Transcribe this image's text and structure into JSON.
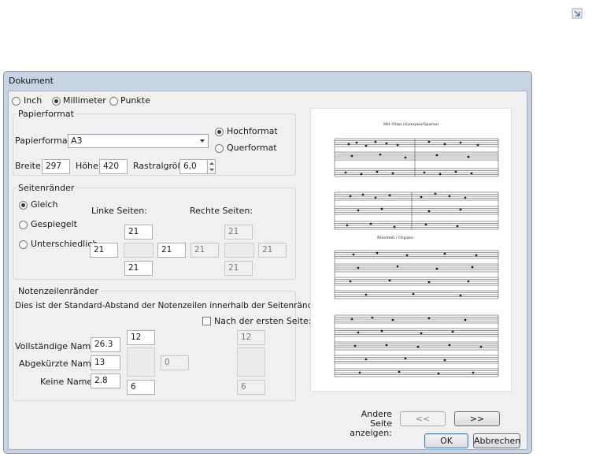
{
  "dialog": {
    "title": "Dokument"
  },
  "units": {
    "options": [
      "Inch",
      "Millimeter",
      "Punkte"
    ],
    "selected": "Millimeter"
  },
  "paper": {
    "group_title": "Papierformat",
    "format_label": "Papierformat:",
    "format_value": "A3",
    "orientation": [
      "Hochformat",
      "Querformat"
    ],
    "orientation_selected": "Hochformat",
    "width_label": "Breite:",
    "width_value": "297",
    "height_label": "Höhe:",
    "height_value": "420",
    "staff_size_label": "Rastralgröße:",
    "staff_size_value": "6,0"
  },
  "margins": {
    "group_title": "Seitenränder",
    "modes": [
      "Gleich",
      "Gespiegelt",
      "Unterschiedlich"
    ],
    "mode_selected": "Gleich",
    "left_pages_label": "Linke Seiten:",
    "right_pages_label": "Rechte Seiten:",
    "left": {
      "top": "21",
      "left": "21",
      "right": "21",
      "bottom": "21"
    },
    "right": {
      "top": "21",
      "left": "21",
      "right": "21",
      "bottom": "21"
    }
  },
  "staff_margins": {
    "group_title": "Notenzeilenränder",
    "description": "Dies ist der Standard-Abstand der Notenzeilen innerhalb der Seitenränder.",
    "after_first_page_label": "Nach der ersten Seite:",
    "full_names_label": "Vollständige Namen:",
    "full_names_value": "26.3",
    "abbrev_names_label": "Abgekürzte Namen:",
    "abbrev_names_value": "13",
    "no_names_label": "Keine Namen:",
    "no_names_value": "2.8",
    "top_value": "12",
    "bottom_value": "6",
    "middle_value": "0",
    "after_top_value": "12",
    "after_bottom_value": "6"
  },
  "preview": {
    "title": "Mit Ornn (Synopsis/Sparse)",
    "section_title": "Ritornell / Organo",
    "other_page_label": "Andere Seite anzeigen:",
    "prev_label": "<<",
    "next_label": ">>"
  },
  "buttons": {
    "ok": "OK",
    "cancel": "Abbrechen"
  },
  "icons": {
    "corner": "resize-corner-icon",
    "radio": "radio-icon",
    "checkbox": "checkbox-icon"
  },
  "colors": {
    "frame": "#c6d4e4",
    "client": "#f0f0f0",
    "accent": "#3c7fb1"
  }
}
